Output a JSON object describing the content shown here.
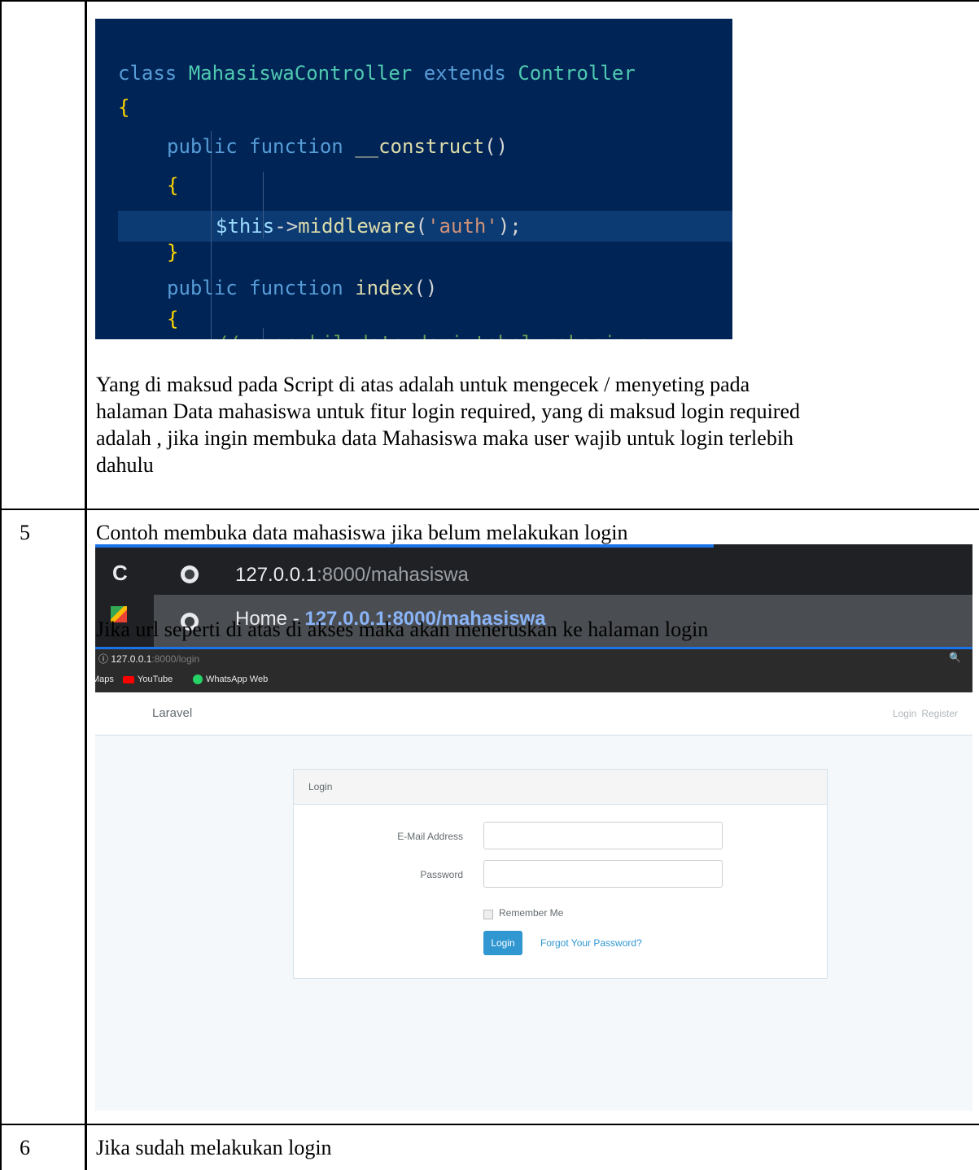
{
  "rows": [
    {
      "number": "",
      "code": {
        "line1": {
          "kw1": "class",
          "name": "MahasiswaController",
          "kw2": "extends",
          "parent": "Controller"
        },
        "line2": "{",
        "line3": {
          "kw1": "public",
          "kw2": "function",
          "name": "__construct",
          "paren": "()"
        },
        "line4": "{",
        "line5": {
          "var": "$this",
          "arrow": "->",
          "fn": "middleware",
          "open": "(",
          "str": "'auth'",
          "close": ");"
        },
        "line6": "}",
        "line7": {
          "kw1": "public",
          "kw2": "function",
          "name": "index",
          "paren": "()"
        },
        "line8": "{",
        "line9": "//mengambil data dari tabel mahasiswa"
      },
      "paragraph": [
        "Yang di maksud pada Script di atas adalah untuk mengecek / menyeting pada",
        "halaman Data mahasiswa untuk fitur login required, yang di maksud login required",
        "adalah , jika ingin membuka data Mahasiswa maka user wajib untuk login terlebih",
        "dahulu"
      ]
    },
    {
      "number": "5",
      "intro": "Contoh membuka data mahasiswa jika belum melakukan login",
      "browser": {
        "reload_icon": "C",
        "url_host": "127.0.0.1",
        "url_path": ":8000/mahasiswa",
        "suggestion_title": "Home - ",
        "suggestion_link": "127.0.0.1:8000/mahasiswa"
      },
      "redirect_text": "Jika url seperti di atas di akses maka akan meneruskan ke halaman login",
      "login_page": {
        "address_host": "127.0.0.1",
        "address_path": ":8000/login",
        "info_icon": "ⓘ",
        "search_icon": "🔍",
        "bookmarks": [
          "Maps",
          "YouTube",
          "WhatsApp Web"
        ],
        "brand": "Laravel",
        "nav_login": "Login",
        "nav_register": "Register",
        "panel_title": "Login",
        "email_label": "E-Mail Address",
        "password_label": "Password",
        "remember_label": "Remember Me",
        "login_button": "Login",
        "forgot_link": "Forgot Your Password?"
      }
    },
    {
      "number": "6",
      "intro": "Jika sudah melakukan login"
    }
  ]
}
